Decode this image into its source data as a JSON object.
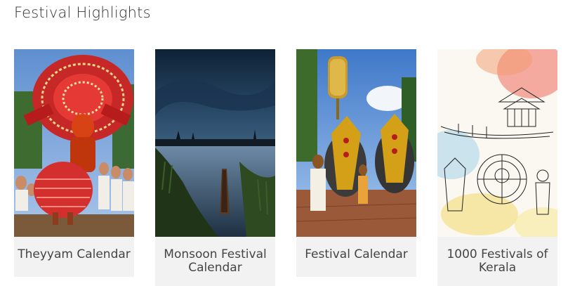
{
  "section": {
    "title": "Festival Highlights"
  },
  "cards": [
    {
      "caption": "Theyyam Calendar",
      "image": "theyyam-performer-photo"
    },
    {
      "caption": "Monsoon Festival Calendar",
      "image": "monsoon-backwaters-photo"
    },
    {
      "caption": "Festival Calendar",
      "image": "temple-elephants-photo"
    },
    {
      "caption": "1000 Festivals of Kerala",
      "image": "watercolor-festival-sketch"
    }
  ]
}
